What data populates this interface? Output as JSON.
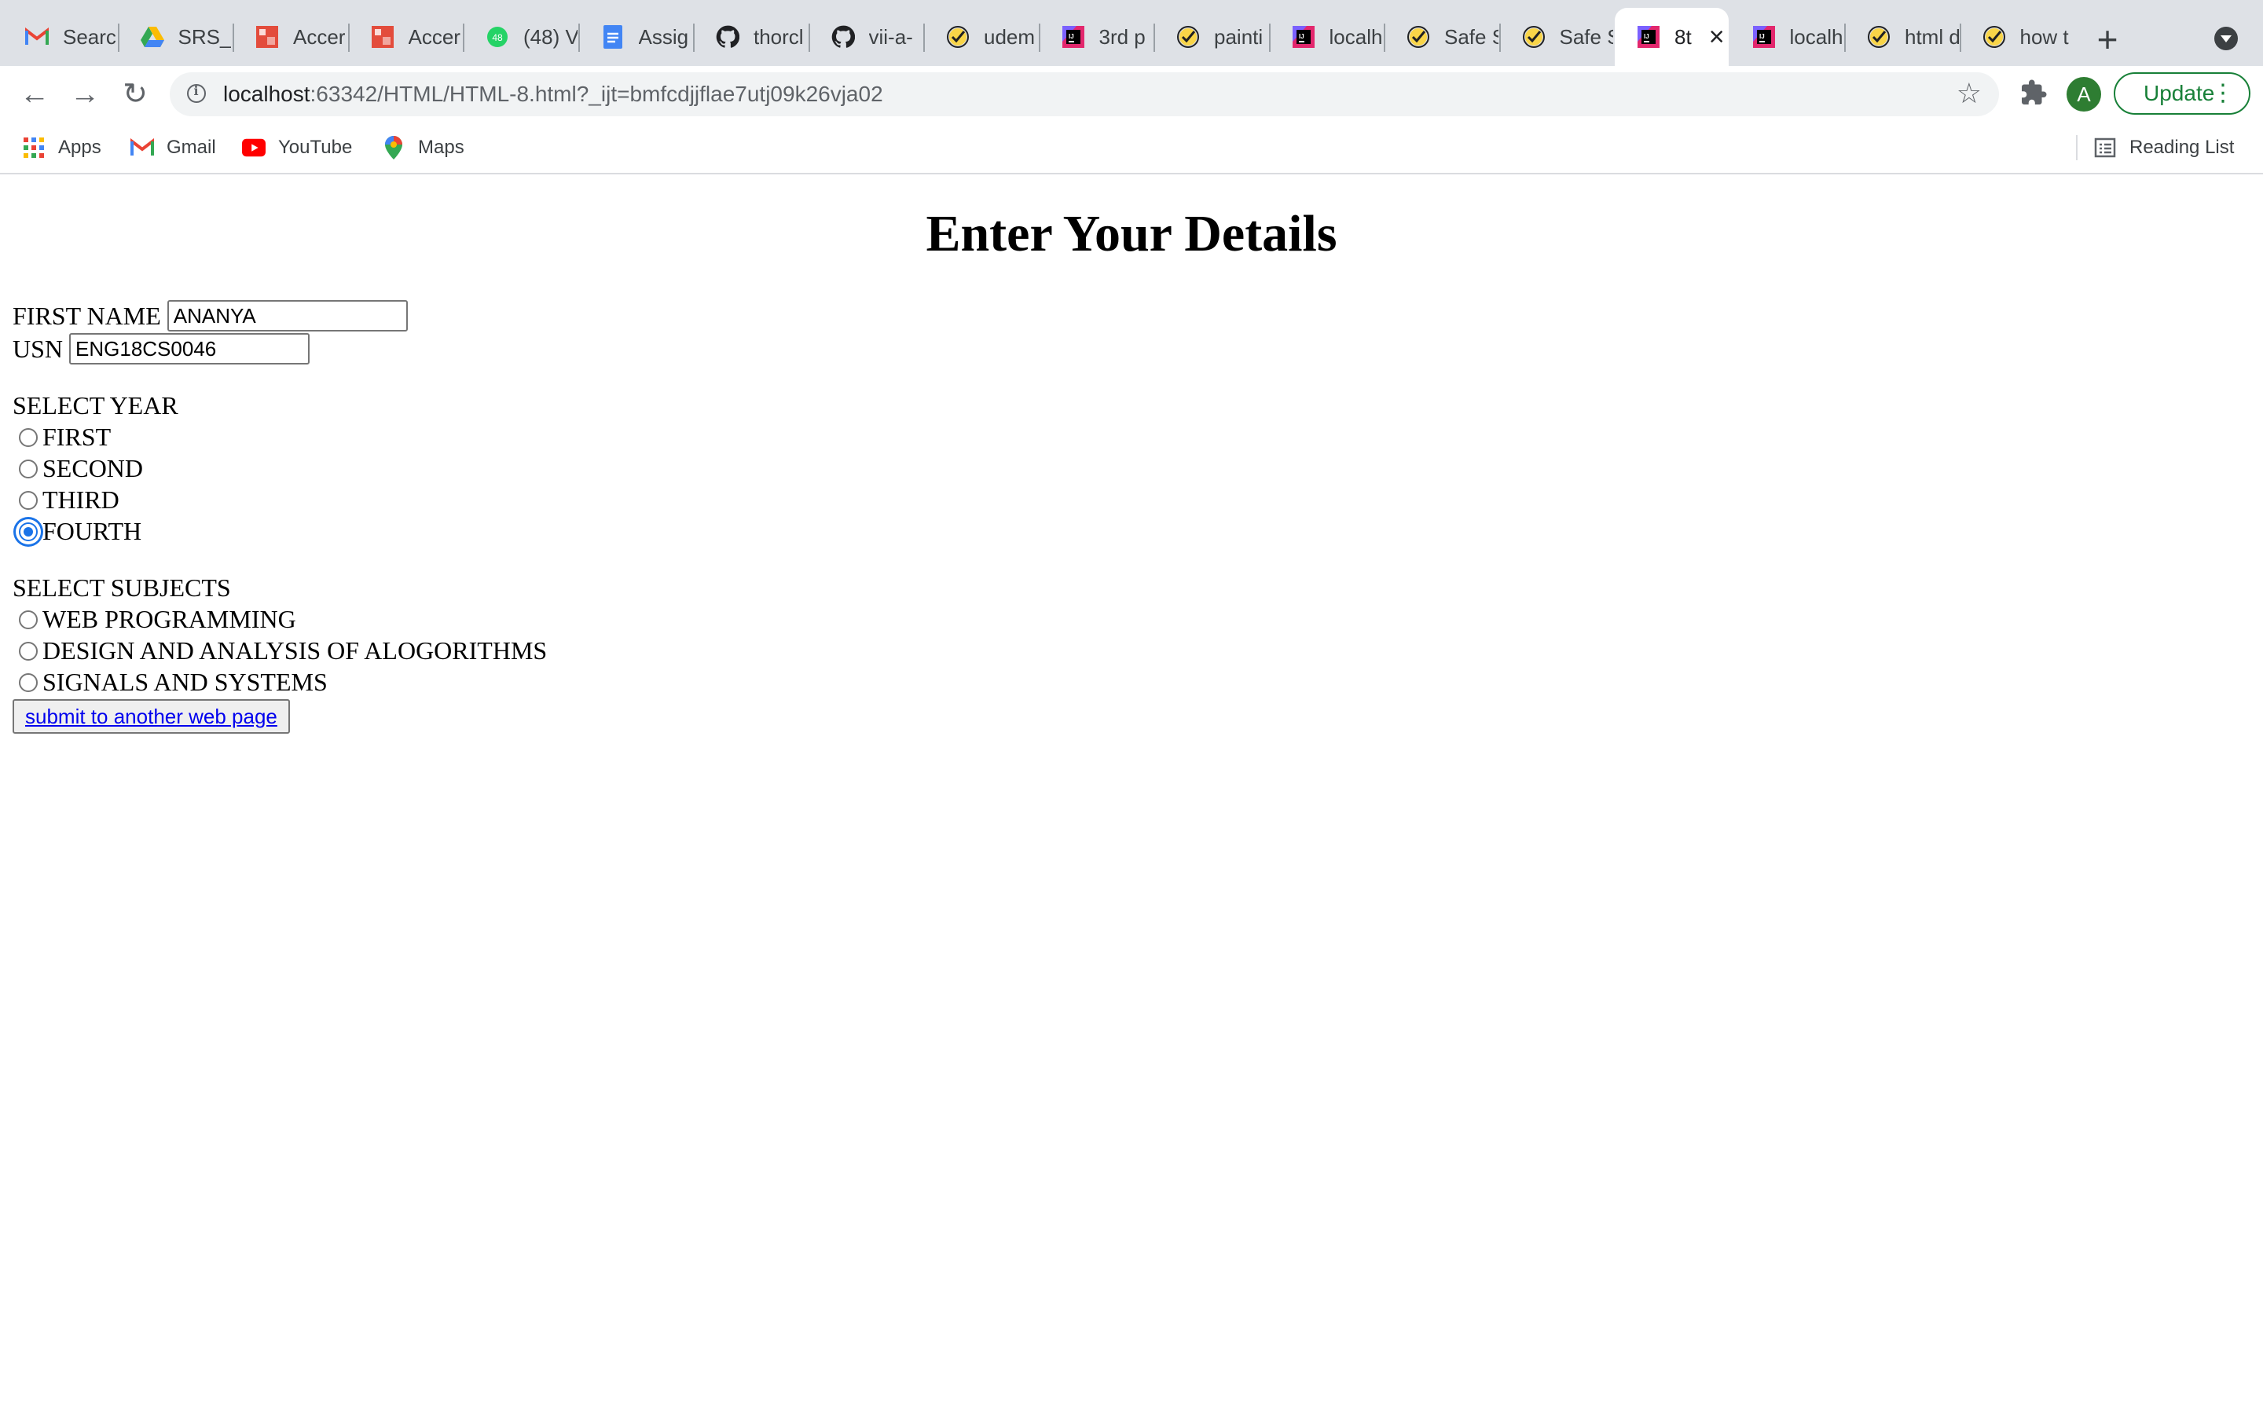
{
  "browser": {
    "tabs": [
      {
        "label": "Searc",
        "icon": "gmail-icon"
      },
      {
        "label": "SRS_",
        "icon": "google-drive-icon"
      },
      {
        "label": "Accer",
        "icon": "accent-icon"
      },
      {
        "label": "Accer",
        "icon": "accent-icon"
      },
      {
        "label": "(48) V",
        "icon": "whatsapp-icon"
      },
      {
        "label": "Assig",
        "icon": "google-docs-icon"
      },
      {
        "label": "thorcl",
        "icon": "github-icon"
      },
      {
        "label": "vii-a-",
        "icon": "github-icon"
      },
      {
        "label": "udem",
        "icon": "checkmark-icon"
      },
      {
        "label": "3rd p",
        "icon": "intellij-icon"
      },
      {
        "label": "painti",
        "icon": "checkmark-icon"
      },
      {
        "label": "localh",
        "icon": "intellij-icon"
      },
      {
        "label": "Safe S",
        "icon": "checkmark-icon"
      },
      {
        "label": "Safe S",
        "icon": "checkmark-icon"
      },
      {
        "label": "8t",
        "icon": "intellij-icon",
        "active": true
      },
      {
        "label": "localh",
        "icon": "intellij-icon"
      },
      {
        "label": "html d",
        "icon": "checkmark-icon"
      },
      {
        "label": "how t",
        "icon": "checkmark-icon"
      }
    ],
    "url_host": "localhost",
    "url_rest": ":63342/HTML/HTML-8.html?_ijt=bmfcdjjflae7utj09k26vja02",
    "avatar_letter": "A",
    "update_label": "Update",
    "bookmarks": {
      "apps": "Apps",
      "gmail": "Gmail",
      "youtube": "YouTube",
      "maps": "Maps",
      "reading_list": "Reading List"
    }
  },
  "page": {
    "title": "Enter Your Details",
    "first_name_label": "FIRST NAME",
    "first_name_value": "ANANYA",
    "usn_label": "USN",
    "usn_value": "ENG18CS0046",
    "year_heading": "SELECT YEAR",
    "years": [
      {
        "label": "FIRST",
        "checked": false
      },
      {
        "label": "SECOND",
        "checked": false
      },
      {
        "label": "THIRD",
        "checked": false
      },
      {
        "label": "FOURTH",
        "checked": true
      }
    ],
    "subjects_heading": "SELECT SUBJECTS",
    "subjects": [
      {
        "label": "WEB PROGRAMMING",
        "checked": false
      },
      {
        "label": "DESIGN AND ANALYSIS OF ALOGORITHMS",
        "checked": false
      },
      {
        "label": "SIGNALS AND SYSTEMS",
        "checked": false
      }
    ],
    "submit_label": "submit to another web page"
  },
  "colors": {
    "accent": "#1a73e8",
    "tabstrip": "#dee1e6",
    "update_green": "#188038"
  }
}
